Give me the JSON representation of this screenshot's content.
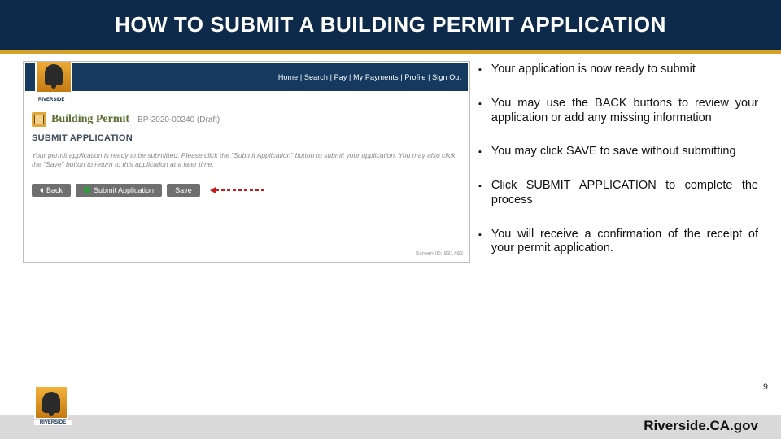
{
  "title": "HOW TO SUBMIT A BUILDING PERMIT APPLICATION",
  "page_number": "9",
  "footer_url": "Riverside.CA.gov",
  "logo_text": "RIVERSIDE",
  "screenshot": {
    "nav": "Home  |  Search  |  Pay  |  My Payments  |  Profile  |  Sign Out",
    "permit_label": "Building Permit",
    "permit_number": "BP-2020-00240 (Draft)",
    "section_heading": "SUBMIT APPLICATION",
    "instructions": "Your permit application is ready to be submitted. Please click the \"Submit Application\" button to submit your application. You may also click the \"Save\" button to return to this application at a later time.",
    "buttons": {
      "back": "Back",
      "submit": "Submit Application",
      "save": "Save"
    },
    "screen_id": "Screen ID: 931492"
  },
  "bullets": [
    "Your application is now ready to submit",
    "You may use the BACK buttons to review your application or add any missing information",
    "You may click SAVE to save without submitting",
    "Click SUBMIT APPLICATION to complete the process",
    "You will receive a confirmation of the receipt of your permit application."
  ]
}
